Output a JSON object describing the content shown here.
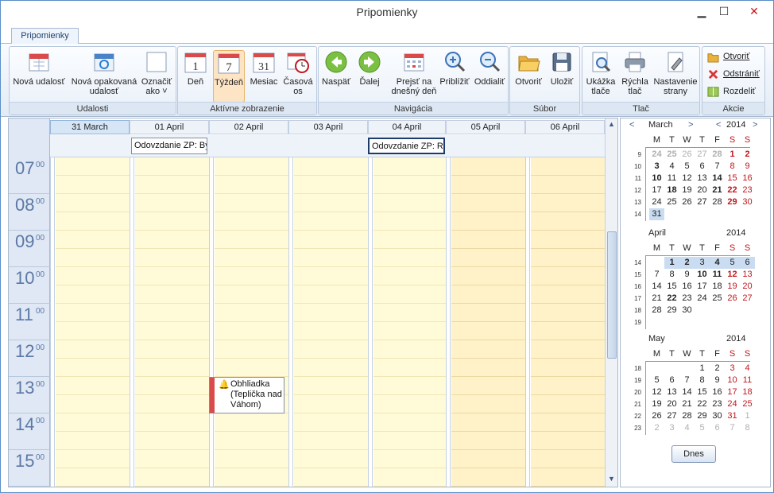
{
  "window": {
    "title": "Pripomienky",
    "minimize": "▁",
    "maximize": "☐",
    "close": "✕",
    "close_color": "#c0171d"
  },
  "tab": {
    "label": "Pripomienky"
  },
  "ribbon": {
    "groups": [
      {
        "label": "Udalosti"
      },
      {
        "label": "Aktívne zobrazenie"
      },
      {
        "label": "Navigácia"
      },
      {
        "label": "Súbor"
      },
      {
        "label": "Tlač"
      },
      {
        "label": "Akcie"
      }
    ],
    "buttons": {
      "nova_udalost": "Nová udalosť",
      "nova_opakovana_1": "Nová opakovaná",
      "nova_opakovana_2": "udalosť",
      "oznacit_1": "Označiť",
      "oznacit_2": "ako ˅",
      "den": "Deň",
      "den_icon": "1",
      "tyzden": "Týždeň",
      "tyzden_icon": "7",
      "mesiac": "Mesiac",
      "mesiac_icon": "31",
      "casova_1": "Časová",
      "casova_2": "os",
      "naspat": "Naspäť",
      "dalej": "Ďalej",
      "prejst_1": "Prejsť na",
      "prejst_2": "dnešný deň",
      "priblizit": "Priblížiť",
      "oddialit": "Oddialiť",
      "otvorit_file": "Otvoriť",
      "ulozit": "Uložiť",
      "ukazka_1": "Ukážka",
      "ukazka_2": "tlače",
      "rychla_1": "Rýchla",
      "rychla_2": "tlač",
      "nastavenie_1": "Nastavenie",
      "nastavenie_2": "strany",
      "otvorit_action": "Otvoriť",
      "odstranit": "Odstrániť",
      "rozdelit": "Rozdeliť"
    }
  },
  "calendar": {
    "days": [
      "31 March",
      "01 April",
      "02 April",
      "03 April",
      "04 April",
      "05 April",
      "06 April"
    ],
    "hours": [
      {
        "h": "07",
        "m": "00"
      },
      {
        "h": "08",
        "m": "00"
      },
      {
        "h": "09",
        "m": "00"
      },
      {
        "h": "10",
        "m": "00"
      },
      {
        "h": "11",
        "m": "00"
      },
      {
        "h": "12",
        "m": "00"
      },
      {
        "h": "13",
        "m": "00"
      },
      {
        "h": "14",
        "m": "00"
      },
      {
        "h": "15",
        "m": "00"
      }
    ],
    "allday_events": [
      "Odovzdanie ZP: By",
      "Odovzdanie ZP: Ro"
    ],
    "appointment": {
      "line1": "Obhliadka",
      "line2": "(Teplička nad",
      "line3": "Váhom)",
      "icon": "bell-icon",
      "color": "#d94a4a"
    }
  },
  "mini_calendars": [
    {
      "month": "March",
      "year": "2014",
      "nav_prev": "<",
      "nav_next": ">",
      "weekdays": [
        "M",
        "T",
        "W",
        "T",
        "F",
        "S",
        "S"
      ],
      "weeks": [
        {
          "n": "9",
          "d": [
            [
              "24",
              "grey bold"
            ],
            [
              "25",
              "grey bold"
            ],
            [
              "26",
              "grey"
            ],
            [
              "27",
              "grey"
            ],
            [
              "28",
              "grey bold"
            ],
            [
              "1",
              "red bold"
            ],
            [
              "2",
              "red bold"
            ]
          ]
        },
        {
          "n": "10",
          "d": [
            [
              "3",
              "bold"
            ],
            [
              "4",
              ""
            ],
            [
              "5",
              ""
            ],
            [
              "6",
              ""
            ],
            [
              "7",
              ""
            ],
            [
              "8",
              "red"
            ],
            [
              "9",
              "red"
            ]
          ]
        },
        {
          "n": "11",
          "d": [
            [
              "10",
              "bold"
            ],
            [
              "11",
              ""
            ],
            [
              "12",
              ""
            ],
            [
              "13",
              ""
            ],
            [
              "14",
              "bold"
            ],
            [
              "15",
              "red"
            ],
            [
              "16",
              "red"
            ]
          ]
        },
        {
          "n": "12",
          "d": [
            [
              "17",
              ""
            ],
            [
              "18",
              "bold"
            ],
            [
              "19",
              ""
            ],
            [
              "20",
              ""
            ],
            [
              "21",
              "bold"
            ],
            [
              "22",
              "red bold"
            ],
            [
              "23",
              "red"
            ]
          ]
        },
        {
          "n": "13",
          "d": [
            [
              "24",
              ""
            ],
            [
              "25",
              ""
            ],
            [
              "26",
              ""
            ],
            [
              "27",
              ""
            ],
            [
              "28",
              ""
            ],
            [
              "29",
              "red bold"
            ],
            [
              "30",
              "red"
            ]
          ]
        },
        {
          "n": "14",
          "d": [
            [
              "31",
              "hl"
            ]
          ]
        }
      ]
    },
    {
      "month": "April",
      "year": "2014",
      "weekdays": [
        "M",
        "T",
        "W",
        "T",
        "F",
        "S",
        "S"
      ],
      "weeks": [
        {
          "n": "14",
          "d": [
            [
              "",
              ""
            ],
            [
              "1",
              "bold hl"
            ],
            [
              "2",
              "bold hl"
            ],
            [
              "3",
              "hl"
            ],
            [
              "4",
              "bold hl"
            ],
            [
              "5",
              "hl"
            ],
            [
              "6",
              "hl"
            ]
          ]
        },
        {
          "n": "15",
          "d": [
            [
              "7",
              ""
            ],
            [
              "8",
              ""
            ],
            [
              "9",
              ""
            ],
            [
              "10",
              "bold"
            ],
            [
              "11",
              "bold"
            ],
            [
              "12",
              "red bold"
            ],
            [
              "13",
              "red"
            ]
          ]
        },
        {
          "n": "16",
          "d": [
            [
              "14",
              ""
            ],
            [
              "15",
              ""
            ],
            [
              "16",
              ""
            ],
            [
              "17",
              ""
            ],
            [
              "18",
              ""
            ],
            [
              "19",
              "red"
            ],
            [
              "20",
              "red"
            ]
          ]
        },
        {
          "n": "17",
          "d": [
            [
              "21",
              ""
            ],
            [
              "22",
              "bold"
            ],
            [
              "23",
              ""
            ],
            [
              "24",
              ""
            ],
            [
              "25",
              ""
            ],
            [
              "26",
              "red"
            ],
            [
              "27",
              "red"
            ]
          ]
        },
        {
          "n": "18",
          "d": [
            [
              "28",
              ""
            ],
            [
              "29",
              ""
            ],
            [
              "30",
              ""
            ]
          ]
        },
        {
          "n": "19",
          "d": []
        }
      ]
    },
    {
      "month": "May",
      "year": "2014",
      "weekdays": [
        "M",
        "T",
        "W",
        "T",
        "F",
        "S",
        "S"
      ],
      "weeks": [
        {
          "n": "18",
          "d": [
            [
              "",
              ""
            ],
            [
              "",
              ""
            ],
            [
              "",
              ""
            ],
            [
              "1",
              ""
            ],
            [
              "2",
              ""
            ],
            [
              "3",
              "red"
            ],
            [
              "4",
              "red"
            ]
          ]
        },
        {
          "n": "19",
          "d": [
            [
              "5",
              ""
            ],
            [
              "6",
              ""
            ],
            [
              "7",
              ""
            ],
            [
              "8",
              ""
            ],
            [
              "9",
              ""
            ],
            [
              "10",
              "red"
            ],
            [
              "11",
              "red"
            ]
          ]
        },
        {
          "n": "20",
          "d": [
            [
              "12",
              ""
            ],
            [
              "13",
              ""
            ],
            [
              "14",
              ""
            ],
            [
              "15",
              ""
            ],
            [
              "16",
              ""
            ],
            [
              "17",
              "red"
            ],
            [
              "18",
              "red"
            ]
          ]
        },
        {
          "n": "21",
          "d": [
            [
              "19",
              ""
            ],
            [
              "20",
              ""
            ],
            [
              "21",
              ""
            ],
            [
              "22",
              ""
            ],
            [
              "23",
              ""
            ],
            [
              "24",
              "red"
            ],
            [
              "25",
              "red"
            ]
          ]
        },
        {
          "n": "22",
          "d": [
            [
              "26",
              ""
            ],
            [
              "27",
              ""
            ],
            [
              "28",
              ""
            ],
            [
              "29",
              ""
            ],
            [
              "30",
              ""
            ],
            [
              "31",
              "red"
            ],
            [
              "1",
              "grey"
            ]
          ]
        },
        {
          "n": "23",
          "d": [
            [
              "2",
              "grey"
            ],
            [
              "3",
              "grey"
            ],
            [
              "4",
              "grey"
            ],
            [
              "5",
              "grey"
            ],
            [
              "6",
              "grey"
            ],
            [
              "7",
              "grey"
            ],
            [
              "8",
              "grey"
            ]
          ]
        }
      ]
    }
  ],
  "today_button": "Dnes"
}
